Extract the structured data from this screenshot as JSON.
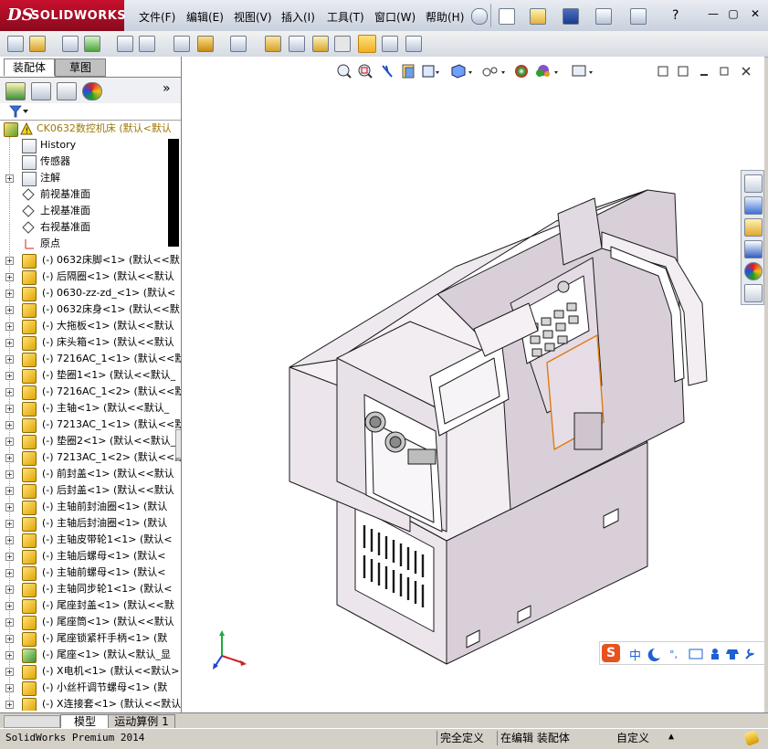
{
  "app": {
    "brand_ds": "DS",
    "brand_name": "SOLIDWORKS"
  },
  "menu": [
    "文件(F)",
    "编辑(E)",
    "视图(V)",
    "插入(I)",
    "工具(T)",
    "窗口(W)",
    "帮助(H)"
  ],
  "window_controls": {
    "help": "?",
    "minimize": "—",
    "restore": "▢",
    "close": "✕"
  },
  "panel_tabs": {
    "assembly": "装配体",
    "sketch": "草图"
  },
  "panel_expand": "»",
  "tree": {
    "root": "CK0632数控机床  (默认<默认",
    "features": [
      {
        "label": "History",
        "icon": "history-icon"
      },
      {
        "label": "传感器",
        "icon": "sensor-icon"
      },
      {
        "label": "注解",
        "icon": "annotation-icon",
        "expandable": true
      },
      {
        "label": "前视基准面",
        "icon": "plane-icon"
      },
      {
        "label": "上视基准面",
        "icon": "plane-icon"
      },
      {
        "label": "右视基准面",
        "icon": "plane-icon"
      },
      {
        "label": "原点",
        "icon": "origin-icon"
      }
    ],
    "components": [
      "(-) 0632床脚<1> (默认<<默",
      "(-) 后隔圈<1> (默认<<默认",
      "(-) 0630-zz-zd_<1> (默认<",
      "(-) 0632床身<1> (默认<<默",
      "(-) 大拖板<1> (默认<<默认",
      "(-) 床头箱<1> (默认<<默认",
      "(-) 7216AC_1<1> (默认<<默",
      "(-) 垫圈1<1> (默认<<默认_",
      "(-) 7216AC_1<2> (默认<<默",
      "(-) 主轴<1> (默认<<默认_",
      "(-) 7213AC_1<1> (默认<<默",
      "(-) 垫圈2<1> (默认<<默认_",
      "(-) 7213AC_1<2> (默认<<默",
      "(-) 前封盖<1> (默认<<默认",
      "(-) 后封盖<1> (默认<<默认",
      "(-) 主轴前封油圈<1> (默认",
      "(-) 主轴后封油圈<1> (默认",
      "(-) 主轴皮带轮1<1> (默认<",
      "(-) 主轴后螺母<1> (默认<",
      "(-) 主轴前螺母<1> (默认<",
      "(-) 主轴同步轮1<1> (默认<",
      "(-) 尾座封盖<1> (默认<<默",
      "(-) 尾座筒<1> (默认<<默认",
      "(-) 尾座锁紧杆手柄<1> (默",
      "(-) 尾座<1> (默认<默认_显",
      "(-) X电机<1> (默认<<默认>",
      "(-) 小丝杆调节螺母<1> (默",
      "(-) X连接套<1> (默认<<默认"
    ]
  },
  "bottom_tabs": [
    "模型",
    "运动算例 1"
  ],
  "status": {
    "product": "SolidWorks Premium 2014",
    "definition": "完全定义",
    "editing": "在编辑 装配体",
    "custom": "自定义"
  },
  "ime": {
    "logo": "S",
    "mode": "中"
  },
  "colors": {
    "model_fill": "#e4dbe4",
    "model_stroke": "#1a1a1a",
    "highlight_edge": "#e07a10",
    "brand_red": "#c8102e"
  }
}
